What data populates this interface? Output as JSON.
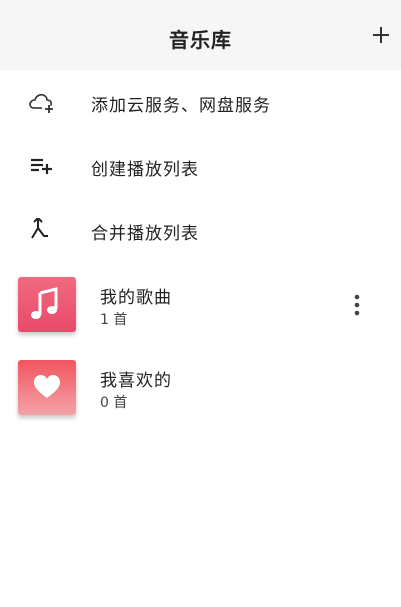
{
  "header": {
    "title": "音乐库",
    "add_icon": "plus-icon"
  },
  "actions": [
    {
      "label": "添加云服务、网盘服务",
      "icon": "cloud-add-icon"
    },
    {
      "label": "创建播放列表",
      "icon": "playlist-add-icon"
    },
    {
      "label": "合并播放列表",
      "icon": "merge-icon"
    }
  ],
  "playlists": [
    {
      "name": "我的歌曲",
      "count": "1 首",
      "icon": "music-note-icon",
      "color_top": "#f06a7f",
      "color_bottom": "#e84a6a"
    },
    {
      "name": "我喜欢的",
      "count": "0 首",
      "icon": "heart-icon",
      "color_top": "#f2555f",
      "color_bottom": "#f3a3a8"
    }
  ],
  "more_icon": "more-vertical-icon"
}
